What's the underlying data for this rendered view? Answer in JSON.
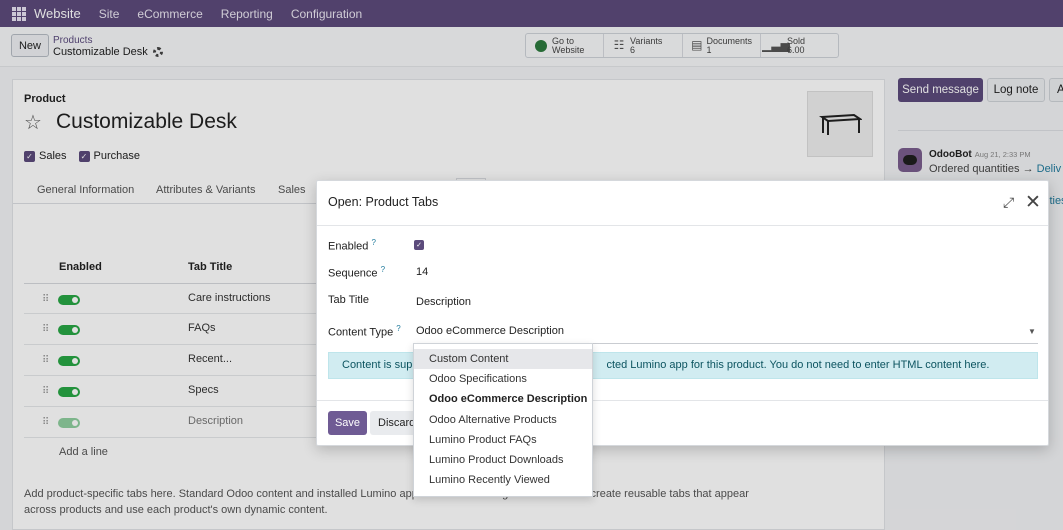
{
  "navbar": {
    "brand": "Website",
    "menu": [
      "Site",
      "eCommerce",
      "Reporting",
      "Configuration"
    ]
  },
  "control_panel": {
    "new_label": "New",
    "breadcrumb_parent": "Products",
    "breadcrumb_current": "Customizable Desk",
    "stats": [
      {
        "icon": "globe-icon",
        "line1": "Go to",
        "line2": "Website"
      },
      {
        "icon": "variants-icon",
        "line1": "Variants",
        "line2": "6"
      },
      {
        "icon": "document-icon",
        "line1": "Documents",
        "line2": "1"
      },
      {
        "icon": "chart-icon",
        "line1": "Sold",
        "line2": "6.00"
      }
    ]
  },
  "form": {
    "product_label": "Product",
    "title": "Customizable Desk",
    "sales_label": "Sales",
    "purchase_label": "Purchase",
    "tabs": [
      "General Information",
      "Attributes & Variants",
      "Sales"
    ],
    "columns": [
      "Enabled",
      "Tab Title"
    ],
    "rows": [
      {
        "title": "Care instructions"
      },
      {
        "title": "FAQs"
      },
      {
        "title": "Recent..."
      },
      {
        "title": "Specs"
      },
      {
        "title": "Description"
      }
    ],
    "add_line": "Add a line",
    "help_text_left": "Add product-specific tabs here. Standard Odoo content and installed Lumino apps c",
    "help_text_right": "se Manage Global Tabs to create reusable tabs that appear",
    "help_text_line2": "across products and use each product's own dynamic content."
  },
  "chatter": {
    "send_message": "Send message",
    "log_note": "Log note",
    "third_button": "A",
    "author": "OdooBot",
    "date": "Aug 21, 2:33 PM",
    "message": "Ordered quantities",
    "arrow": "→",
    "link_text": "Deliv",
    "link_text2": "ities"
  },
  "modal": {
    "title": "Open: Product Tabs",
    "enabled_label": "Enabled",
    "sequence_label": "Sequence",
    "sequence_value": "14",
    "tab_title_label": "Tab Title",
    "tab_title_value": "Description",
    "content_type_label": "Content Type",
    "content_type_value": "Odoo eCommerce Description",
    "help_marker": "?",
    "alert_left": "Content is supp",
    "alert_right": "cted Lumino app for this product. You do not need to enter HTML content here.",
    "save_label": "Save",
    "discard_label": "Discard"
  },
  "dropdown": {
    "options": [
      "Custom Content",
      "Odoo Specifications",
      "Odoo eCommerce Description",
      "Odoo Alternative Products",
      "Lumino Product FAQs",
      "Lumino Product Downloads",
      "Lumino Recently Viewed"
    ],
    "hovered_index": 0,
    "selected_index": 2
  },
  "colors": {
    "navbar": "#5d4b7c",
    "primary": "#5c4b7c",
    "toggle_on": "#28a745",
    "alert_bg": "#d1ecf1"
  }
}
